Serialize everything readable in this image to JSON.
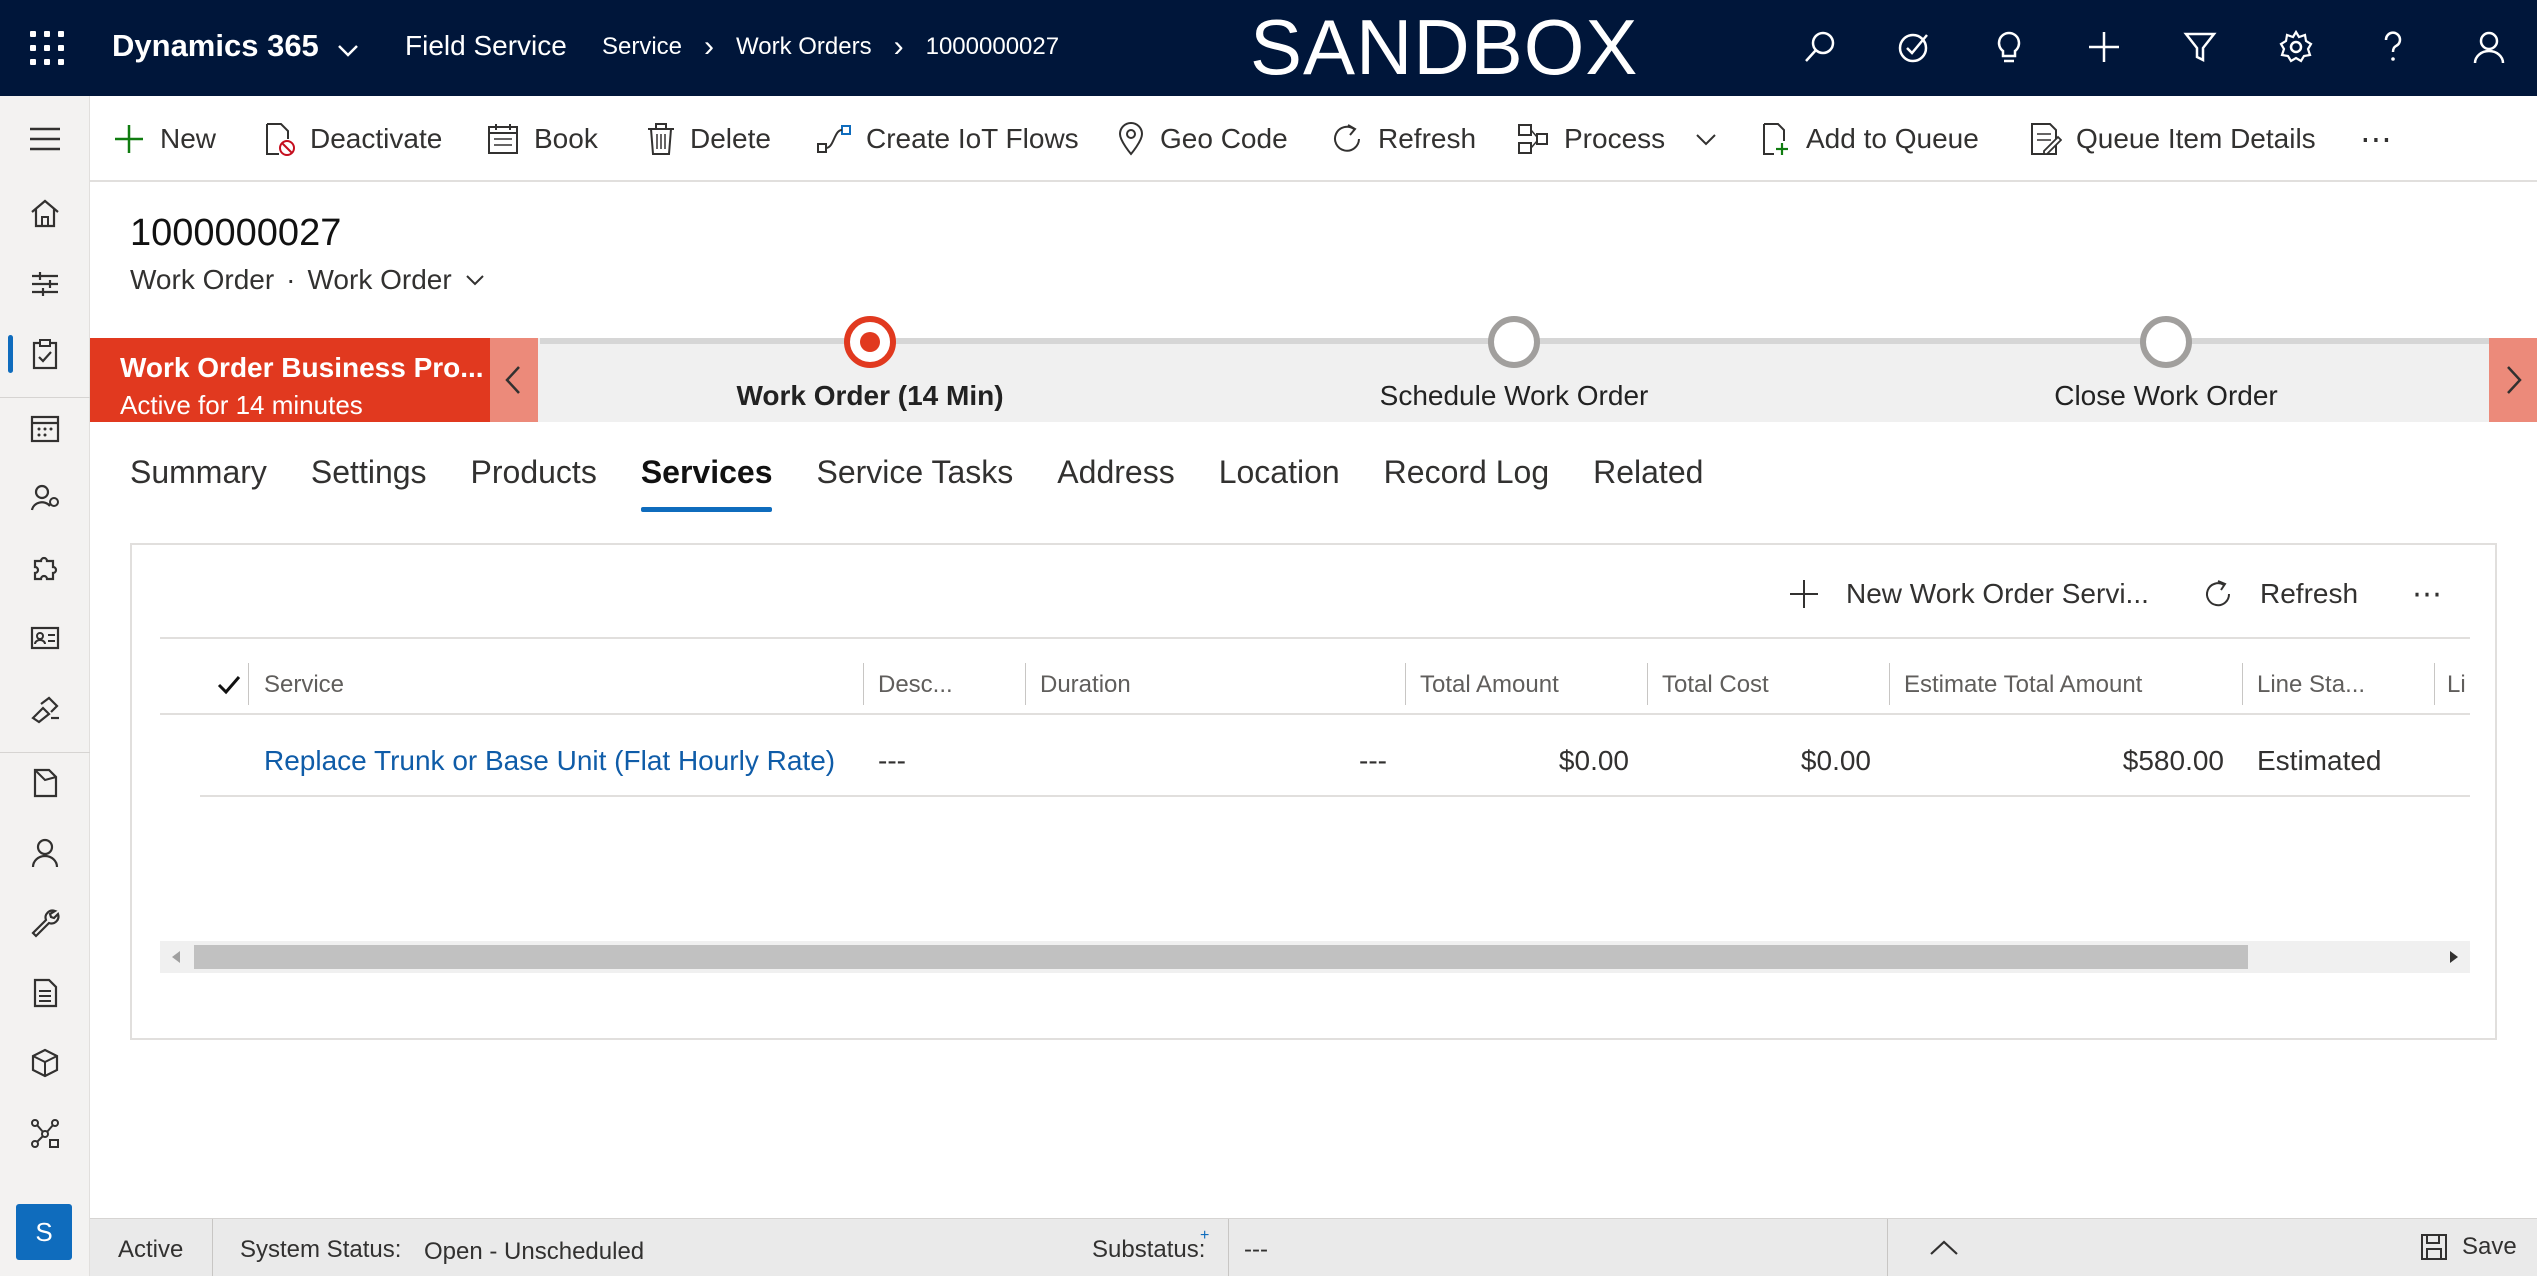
{
  "topbar": {
    "app_name": "Dynamics 365",
    "module": "Field Service",
    "breadcrumbs": [
      "Service",
      "Work Orders",
      "1000000027"
    ],
    "environment_label": "SANDBOX",
    "icons": [
      "search-icon",
      "task-check-icon",
      "lightbulb-icon",
      "plus-icon",
      "filter-icon",
      "gear-icon",
      "help-icon",
      "user-icon"
    ]
  },
  "leftrail": {
    "items": [
      "menu-icon",
      "home-icon",
      "sitemap-icon",
      "work-orders-icon",
      "calendar-icon",
      "resources-icon",
      "puzzle-icon",
      "contact-card-icon",
      "agreement-icon",
      "document-icon",
      "person-icon",
      "wrench-icon",
      "list-document-icon",
      "package-icon",
      "network-icon"
    ],
    "avatar_initial": "S"
  },
  "commandbar": {
    "new": "New",
    "deactivate": "Deactivate",
    "book": "Book",
    "delete": "Delete",
    "create_iot_flows": "Create IoT Flows",
    "geo_code": "Geo Code",
    "refresh": "Refresh",
    "process": "Process",
    "add_to_queue": "Add to Queue",
    "queue_item_details": "Queue Item Details",
    "more": "⋯"
  },
  "header": {
    "title": "1000000027",
    "entity": "Work Order",
    "form_name": "Work Order"
  },
  "bpf": {
    "flow_name": "Work Order Business Pro...",
    "flow_state": "Active for 14 minutes",
    "stages": [
      {
        "name": "Work Order  (14 Min)",
        "active": true
      },
      {
        "name": "Schedule Work Order",
        "active": false
      },
      {
        "name": "Close Work Order",
        "active": false
      }
    ]
  },
  "tabs": [
    "Summary",
    "Settings",
    "Products",
    "Services",
    "Service Tasks",
    "Address",
    "Location",
    "Record Log",
    "Related"
  ],
  "selected_tab": "Services",
  "subgrid": {
    "commands": {
      "new": "New Work Order Servi...",
      "refresh": "Refresh",
      "more": "⋯"
    },
    "columns": [
      "Service",
      "Desc...",
      "Duration",
      "Total Amount",
      "Total Cost",
      "Estimate Total Amount",
      "Line Sta...",
      "Li"
    ],
    "rows": [
      {
        "service": "Replace Trunk or Base Unit (Flat Hourly Rate)",
        "description": "---",
        "duration": "---",
        "total_amount": "$0.00",
        "total_cost": "$0.00",
        "estimate_total_amount": "$580.00",
        "line_status": "Estimated"
      }
    ],
    "horizontal_scroll_fraction": 0.89
  },
  "footer": {
    "status": "Active",
    "system_status_label": "System Status:",
    "system_status_value": "Open - Unscheduled",
    "substatus_label": "Substatus:",
    "substatus_marker": "+",
    "substatus_value": "---",
    "save": "Save"
  },
  "colors": {
    "topbar": "#00163a",
    "accent": "#0f6cbd",
    "bpf_active": "#e1391f",
    "link": "#0f5ca8"
  }
}
